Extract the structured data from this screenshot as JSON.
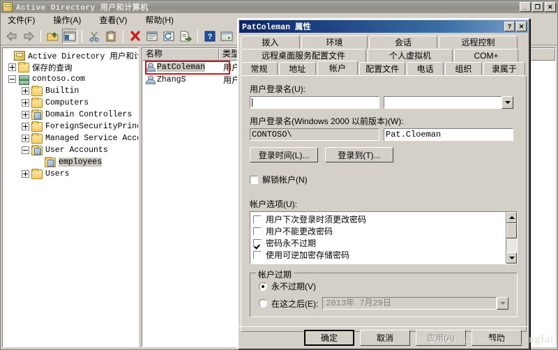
{
  "window": {
    "title": "Active Directory 用户和计算机",
    "icon": "console-root-icon",
    "buttons": {
      "minimize": "_",
      "restore": "❐",
      "close": "✕"
    }
  },
  "menu": [
    {
      "label": "文件(F)",
      "name": "menu-file"
    },
    {
      "label": "操作(A)",
      "name": "menu-action"
    },
    {
      "label": "查看(V)",
      "name": "menu-view"
    },
    {
      "label": "帮助(H)",
      "name": "menu-help"
    }
  ],
  "toolbar": [
    {
      "name": "back-icon"
    },
    {
      "name": "forward-icon"
    },
    {
      "name": "up-folder-icon"
    },
    {
      "name": "show-hide-tree-icon"
    },
    {
      "name": "cut-icon"
    },
    {
      "name": "paste-icon"
    },
    {
      "name": "delete-icon"
    },
    {
      "name": "properties-icon"
    },
    {
      "name": "refresh-icon"
    },
    {
      "name": "export-list-icon"
    },
    {
      "name": "help-icon"
    },
    {
      "name": "console-icon"
    },
    {
      "name": "new-user-icon"
    }
  ],
  "tree": {
    "items": [
      {
        "label": "Active Directory 用户和计算机",
        "indent": 0,
        "state": "none",
        "icon": "console-root-icon",
        "selected": false
      },
      {
        "label": "保存的查询",
        "indent": 1,
        "state": "plus",
        "icon": "folder-icon",
        "selected": false
      },
      {
        "label": "contoso.com",
        "indent": 1,
        "state": "minus",
        "icon": "domain-icon",
        "selected": false
      },
      {
        "label": "Builtin",
        "indent": 2,
        "state": "plus",
        "icon": "folder-icon",
        "selected": false
      },
      {
        "label": "Computers",
        "indent": 2,
        "state": "plus",
        "icon": "folder-icon",
        "selected": false
      },
      {
        "label": "Domain Controllers",
        "indent": 2,
        "state": "plus",
        "icon": "ou-folder-icon",
        "selected": false
      },
      {
        "label": "ForeignSecurityPrincip",
        "indent": 2,
        "state": "plus",
        "icon": "folder-icon",
        "selected": false
      },
      {
        "label": "Managed Service Accour",
        "indent": 2,
        "state": "plus",
        "icon": "folder-icon",
        "selected": false
      },
      {
        "label": "User Accounts",
        "indent": 2,
        "state": "minus",
        "icon": "ou-folder-icon",
        "selected": false
      },
      {
        "label": "employees",
        "indent": 3,
        "state": "none",
        "icon": "ou-folder-icon",
        "selected": true
      },
      {
        "label": "Users",
        "indent": 2,
        "state": "plus",
        "icon": "folder-icon",
        "selected": false
      }
    ]
  },
  "list": {
    "columns": [
      "名称",
      "类型"
    ],
    "rows": [
      {
        "name": "PatColeman",
        "type": "用户",
        "selected": true,
        "annotated": true
      },
      {
        "name": "ZhangS",
        "type": "用户",
        "selected": false,
        "annotated": false
      }
    ]
  },
  "dialog": {
    "title": "PatColeman 属性",
    "title_buttons": {
      "help": "?",
      "close": "✕"
    },
    "tab_rows": [
      [
        {
          "label": "拨入",
          "selected": false
        },
        {
          "label": "环境",
          "selected": false
        },
        {
          "label": "会话",
          "selected": false
        },
        {
          "label": "远程控制",
          "selected": false
        }
      ],
      [
        {
          "label": "远程桌面服务配置文件",
          "selected": false
        },
        {
          "label": "个人虚拟机",
          "selected": false
        },
        {
          "label": "COM+",
          "selected": false
        }
      ],
      [
        {
          "label": "常规",
          "selected": false
        },
        {
          "label": "地址",
          "selected": false
        },
        {
          "label": "帐户",
          "selected": true
        },
        {
          "label": "配置文件",
          "selected": false
        },
        {
          "label": "电话",
          "selected": false
        },
        {
          "label": "组织",
          "selected": false
        },
        {
          "label": "隶属于",
          "selected": false
        }
      ]
    ],
    "account": {
      "logon_name_label": "用户登录名(U):",
      "logon_name_value": "",
      "logon_suffix_value": "",
      "pre2000_label": "用户登录名(Windows 2000 以前版本)(W):",
      "pre2000_domain": "CONTOSO\\",
      "pre2000_value": "Pat.Cloeman",
      "logon_hours_button": "登录时间(L)...",
      "log_on_to_button": "登录到(T)...",
      "unlock_label": "解锁帐户(N)",
      "unlock_checked": false,
      "options_label": "帐户选项(U):",
      "options": [
        {
          "label": "用户下次登录时须更改密码",
          "checked": false
        },
        {
          "label": "用户不能更改密码",
          "checked": false
        },
        {
          "label": "密码永不过期",
          "checked": true
        },
        {
          "label": "使用可逆加密存储密码",
          "checked": false
        }
      ],
      "expiry_group_title": "帐户过期",
      "never_label": "永不过期(V)",
      "never_selected": true,
      "end_of_label": "在这之后(E):",
      "end_of_selected": false,
      "end_of_date": "2013年 7月29日"
    },
    "footer": [
      {
        "label": "确定",
        "style": "default",
        "enabled": true
      },
      {
        "label": "取消",
        "style": "normal",
        "enabled": true
      },
      {
        "label": "应用(A)",
        "style": "normal",
        "enabled": false
      },
      {
        "label": "帮助",
        "style": "normal",
        "enabled": true
      }
    ]
  },
  "watermark": "http://blog.csdn.net/zjingfai"
}
